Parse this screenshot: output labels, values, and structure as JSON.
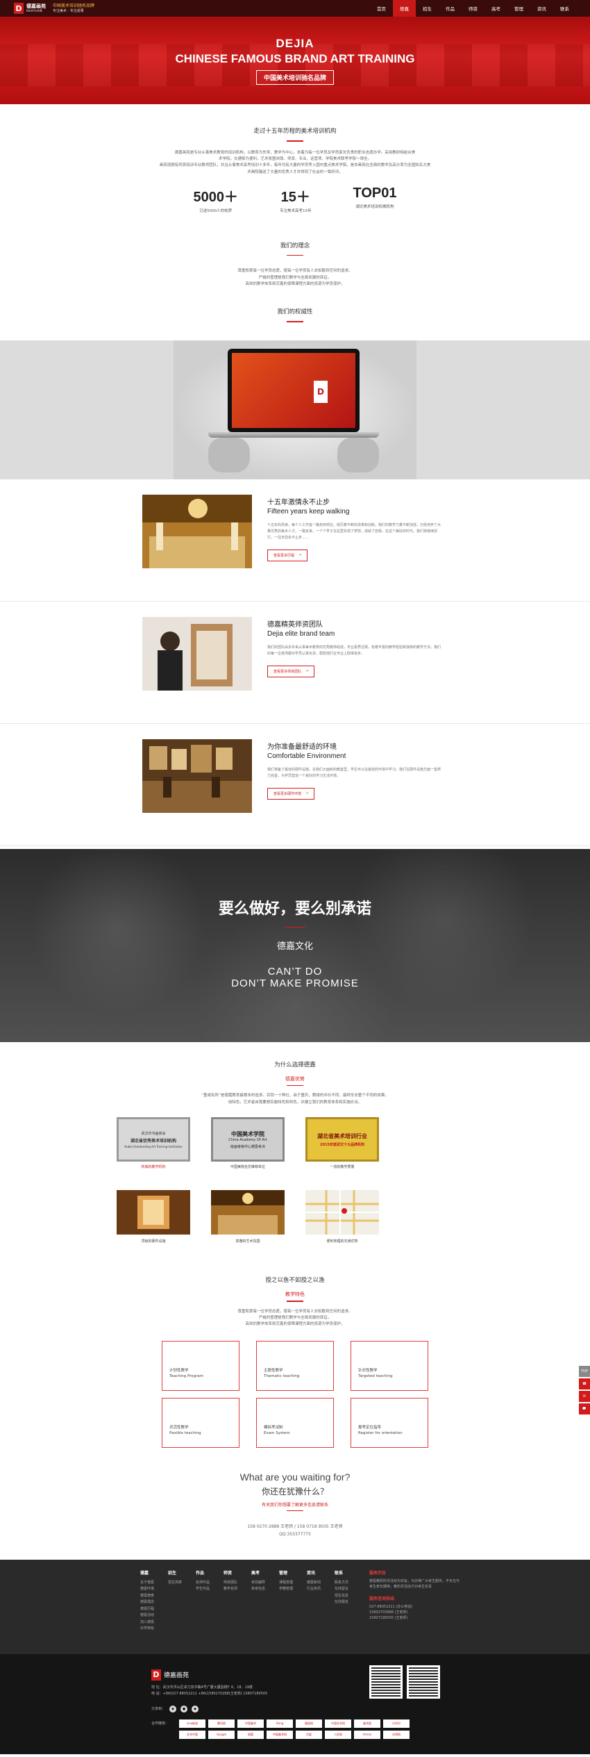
{
  "brand": {
    "logo_mark": "D",
    "logo_cn": "德嘉画苑",
    "logo_en": "HUAYUAN",
    "slogan1": "中国美术培训驰名品牌",
    "slogan2": "专注美术 · 专注成果"
  },
  "nav": [
    "首页",
    "德嘉",
    "招生",
    "作品",
    "师资",
    "高考",
    "管理",
    "资讯",
    "联系"
  ],
  "hero": {
    "title1": "DEJIA",
    "title2": "CHINESE FAMOUS BRAND ART TRAINING",
    "badge": "中国美术培训驰名品牌"
  },
  "intro": {
    "title": "走过十五年历程的美术培训机构",
    "text": [
      "德嘉画苑是专业从事美术教育的培训机构，以教育为先导，教学为中心，本着为每一位学员及学员家长负责的职业态度办学。采用教研相结合美",
      "术学院，交通极为便利，艺术氛围浓厚。师资、专业、运营项、学院美术联考学院一律全。",
      "画苑现拥有师资培训专业教师团队，并且从事美术高考培训十多年，每年均有大量的学员考入国内重点美术学院。是本画苑在全面的教学及高分率为全国知名大美",
      "术画院输送了大量的优秀人才并得到了社会的一致好评。"
    ],
    "stats": [
      {
        "num": "5000＋",
        "label": "已送5000人的校梦"
      },
      {
        "num": "15＋",
        "label": "专注美术高考15年"
      },
      {
        "num": "TOP01",
        "label": "湖北美术培训权威机构"
      }
    ]
  },
  "concept": {
    "title": "我们的理念",
    "text": [
      "尊重和爱每一位学员态度，使每一位学员有人去松散到任何的追求。",
      "严格的管理是我们教学与全面发展的保证。",
      "高效的教学体系和完善的保障课程方面的资源为学员保护。"
    ]
  },
  "authority": {
    "title": "我们的权威性",
    "screen_logo": "D"
  },
  "features": [
    {
      "cn": "十五年激情永不止步",
      "en": "Fifteen years keep walking",
      "desc": "十五年的风雨，每个人工作室一路走到现在，经历着不断的改革和创新。我们的教学力量不断加强，已经培养了大量优秀的美术人才。一路走来，一个个学子在这里实现了梦想，成就了自我，在这个美好的时代，我们将继续前行，一往无前永不止步……",
      "btn": "查看更多历程"
    },
    {
      "cn": "德嘉精英师资团队",
      "en": "Dejia elite brand team",
      "desc": "我们的团队由多年来从事美术教育的优秀教师组成，专业素质过硬，有着丰富的教学经验和独特的教学方法，我们的每一位老师都对学员认真负责，帮助他们在专业上取得进步。",
      "btn": "查看更多师资团队"
    },
    {
      "cn": "为你准备最舒适的环境",
      "en": "Comfortable Environment",
      "desc": "我们准备了最佳的硬件设施。在我们大面积的教室里，学生可以在最佳的环境中学习。我们在硬件设施方面一直努力完善，为学员营造一个良好的学习生活环境。",
      "btn": "查看更多硬件环境"
    }
  ],
  "promise": {
    "title": "要么做好，要么别承诺",
    "sub": "德嘉文化",
    "en1": "CAN’T DO",
    "en2": "DON’T MAKE PROMISE"
  },
  "why": {
    "title": "为什么选择德嘉",
    "sub": "德嘉优势",
    "text": [
      "“重或有所”是德嘉教育最根本的追求。目同一十种社，由于重庆，教授的评价不同，最终形去整个不同的效果。",
      "用特色，艺术者自我要想实施特色和特色，并建立我们的教育体系和实施办法。"
    ],
    "tiles": [
      {
        "label": "权威的教学机构"
      },
      {
        "label": "中国美院名优推荐单位"
      },
      {
        "label": "一流的教学质量"
      },
      {
        "label": "顶级的硬件设施"
      },
      {
        "label": "高雅的艺术氛围"
      },
      {
        "label": "便利地理的交通优势"
      }
    ],
    "plaques": [
      {
        "top": "武汉市书画商会",
        "mid": "湖北省优秀美术培训机构",
        "sub": "Hubei Outstanding Art Training Institution"
      },
      {
        "top": "中国美术学院",
        "mid": "China Academy Of Art",
        "sub": "绘画考级中心德嘉考点"
      },
      {
        "top": "湖北省美术培训行业",
        "mid": "2015年度武汉十大品牌机构",
        "sub": ""
      }
    ]
  },
  "teach": {
    "title": "授之以鱼不如授之以渔",
    "sub": "教学特色",
    "text": [
      "尊重和爱每一位学员态度，使每一位学员有人去松散到任何的追求。",
      "严格的管理是我们教学与全面发展的保证。",
      "高效的教学体系和完善的保障课程方面的资源为学员保护。"
    ],
    "boxes": [
      {
        "cn": "计划性教学",
        "en": "Teaching Program"
      },
      {
        "cn": "主题性教学",
        "en": "Thematic teaching"
      },
      {
        "cn": "针对性教学",
        "en": "Targeted teaching"
      },
      {
        "cn": "灵活性教学",
        "en": "flexible teaching"
      },
      {
        "cn": "模拟考试制",
        "en": "Exam System"
      },
      {
        "cn": "报考定位指导",
        "en": "Register for orientation"
      }
    ]
  },
  "waiting": {
    "en": "What are you waiting for?",
    "cn": "你还在犹豫什么？",
    "red": "有关我们你想要了解更多信息请联系",
    "tel1": "158 0270 2888 王老师 / 158 0718 9505 王老师",
    "tel2": "QQ:353377775"
  },
  "footer": {
    "cols": [
      {
        "h": "德嘉",
        "items": [
          "关于德嘉",
          "德嘉环境",
          "德嘉宿舍",
          "德嘉理念",
          "德嘉历程",
          "德嘉活动",
          "加入德嘉",
          "办学特色"
        ]
      },
      {
        "h": "招生",
        "items": [
          "招生简章"
        ]
      },
      {
        "h": "作品",
        "items": [
          "名师作品",
          "学生作品"
        ]
      },
      {
        "h": "师资",
        "items": [
          "师资团队",
          "教学名师"
        ]
      },
      {
        "h": "高考",
        "items": [
          "考前辅导",
          "高考信息"
        ]
      },
      {
        "h": "管理",
        "items": [
          "课程管理",
          "学籍管理"
        ]
      },
      {
        "h": "资讯",
        "items": [
          "德嘉新闻",
          "行业资讯"
        ]
      },
      {
        "h": "联系",
        "items": [
          "联系方式",
          "在线留言",
          "招生信息",
          "在线报名"
        ]
      }
    ],
    "about_h": "服务宗旨",
    "about_t": "德嘉教研的讯活动为宗旨，为办得广大考生服务，不负在与考生家长期待，教的讯活动才对考生负责",
    "contact_h": "服务咨询热线",
    "contact_t": [
      "027-88052211 (办公电话)",
      "15802703888 (王老师)",
      "15807189505 (王老师)"
    ],
    "addr": [
      "地 址：武汉市洪山区卓刀泉中路4号广厦大厦副楼F. 6、18、19楼",
      "电 话：+86(027-88052211 +86(1580270288(王老师) 15807189505"
    ],
    "share_label": "分享到：",
    "partner_label": "合作媒体：",
    "partners": [
      "sina新浪",
      "腾讯网",
      "中国美术",
      "iFeng",
      "雅昌网",
      "中国艺术网",
      "美术报",
      "LOGO",
      "艺术中国",
      "Google",
      "搜狐",
      "中国美术网",
      "百度",
      "人民网",
      "Artron",
      "光明网"
    ]
  },
  "side": [
    "TOP",
    "☎",
    "✉",
    "💬"
  ]
}
